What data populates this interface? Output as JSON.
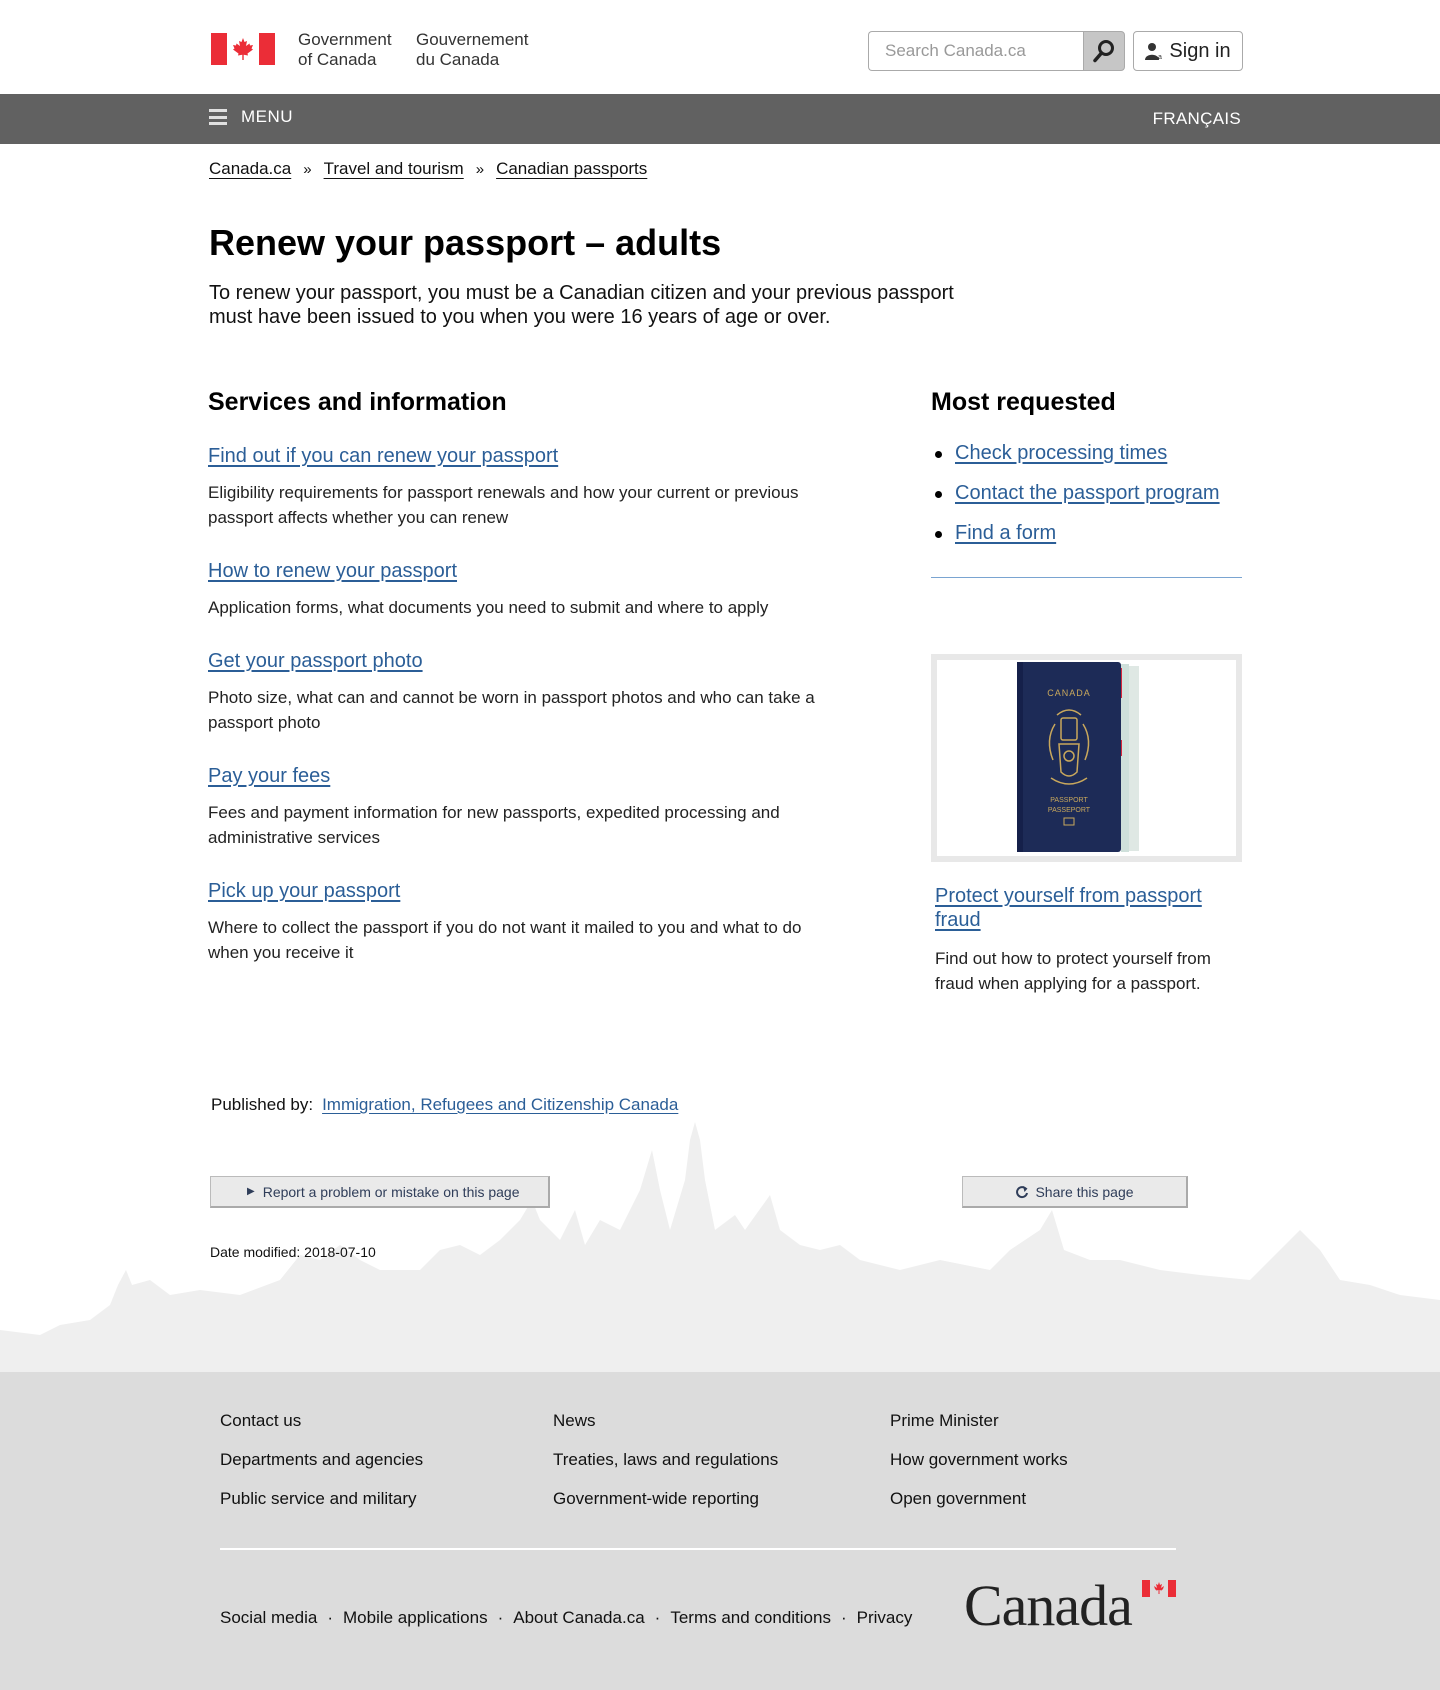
{
  "header": {
    "signature_en_line1": "Government",
    "signature_en_line2": "of Canada",
    "signature_fr_line1": "Gouvernement",
    "signature_fr_line2": "du Canada",
    "search_placeholder": "Search Canada.ca",
    "signin_label": "Sign in",
    "flag_color": "#eb2d37"
  },
  "menubar": {
    "menu_label": "MENU",
    "language_label": "FRANÇAIS",
    "background": "#616161"
  },
  "breadcrumb": {
    "items": [
      "Canada.ca",
      "Travel and tourism",
      "Canadian passports"
    ],
    "separator": "»"
  },
  "page": {
    "title": "Renew your passport – adults",
    "intro": "To renew your passport, you must be a Canadian citizen and your previous passport must have been issued to you when you were 16 years of age or over."
  },
  "services": {
    "heading": "Services and information",
    "items": [
      {
        "link": "Find out if you can renew your passport",
        "desc": "Eligibility requirements for passport renewals and how your current or previous passport affects whether you can renew"
      },
      {
        "link": "How to renew your passport",
        "desc": "Application forms, what documents you need to submit and where to apply"
      },
      {
        "link": "Get your passport photo",
        "desc": "Photo size, what can and cannot be worn in passport photos and who can take a passport photo"
      },
      {
        "link": "Pay your fees",
        "desc": "Fees and payment information for new passports, expedited processing and administrative services"
      },
      {
        "link": "Pick up your passport",
        "desc": "Where to collect the passport if you do not want it mailed to you and what to do when you receive it"
      }
    ]
  },
  "most_requested": {
    "heading": "Most requested",
    "items": [
      "Check processing times",
      "Contact the passport program",
      "Find a form"
    ]
  },
  "feature": {
    "image_country": "CANADA",
    "image_label1": "PASSPORT",
    "image_label2": "PASSEPORT",
    "link": "Protect yourself from passport fraud",
    "desc": "Find out how to protect yourself from fraud when applying for a passport."
  },
  "published": {
    "label": "Published by:",
    "link": "Immigration, Refugees and Citizenship Canada"
  },
  "page_actions": {
    "report_label": "Report a problem or mistake on this page",
    "share_label": "Share this page",
    "date_modified": "Date modified: 2018-07-10"
  },
  "footer": {
    "col1": [
      "Contact us",
      "Departments and agencies",
      "Public service and military"
    ],
    "col2": [
      "News",
      "Treaties, laws and regulations",
      "Government-wide reporting"
    ],
    "col3": [
      "Prime Minister",
      "How government works",
      "Open government"
    ],
    "bottom_links": [
      "Social media",
      "Mobile applications",
      "About Canada.ca",
      "Terms and conditions",
      "Privacy"
    ],
    "wordmark": "Canada"
  },
  "colors": {
    "link": "#2b5e97",
    "footer_bg": "#dcdcdc"
  }
}
